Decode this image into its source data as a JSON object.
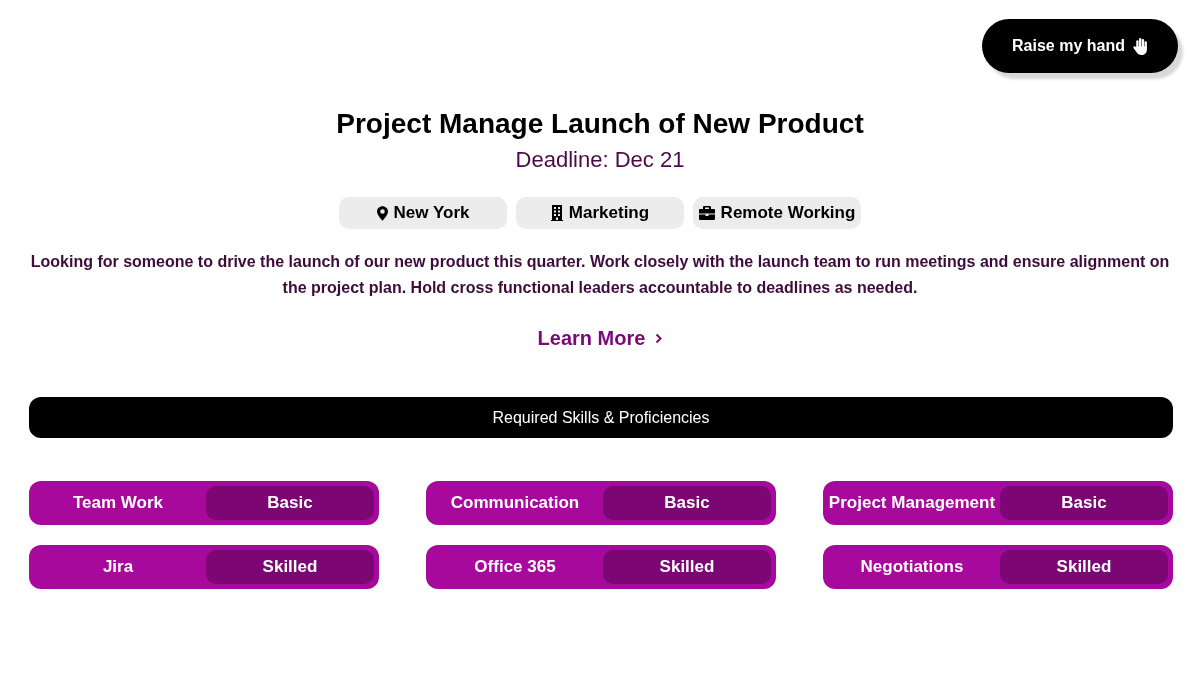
{
  "header": {
    "button": "Raise my hand"
  },
  "job": {
    "title": "Project Manage Launch of New Product",
    "deadline": "Deadline: Dec 21",
    "tags": [
      {
        "label": "New York",
        "kind": "location"
      },
      {
        "label": "Marketing",
        "kind": "department"
      },
      {
        "label": "Remote Working",
        "kind": "work-mode"
      }
    ],
    "description": "Looking for someone to drive the launch of our new product this quarter. Work closely with the launch team to run meetings and ensure alignment on the project plan. Hold cross functional leaders accountable to deadlines as needed.",
    "link": "Learn More"
  },
  "skills": {
    "heading": "Required Skills & Proficiencies",
    "items": [
      {
        "name": "Team Work",
        "proficiency": "Basic"
      },
      {
        "name": "Communication",
        "proficiency": "Basic"
      },
      {
        "name": "Project Management",
        "proficiency": "Basic"
      },
      {
        "name": "Jira",
        "proficiency": "Skilled"
      },
      {
        "name": "Office 365",
        "proficiency": "Skilled"
      },
      {
        "name": "Negotiations",
        "proficiency": "Skilled"
      }
    ]
  }
}
